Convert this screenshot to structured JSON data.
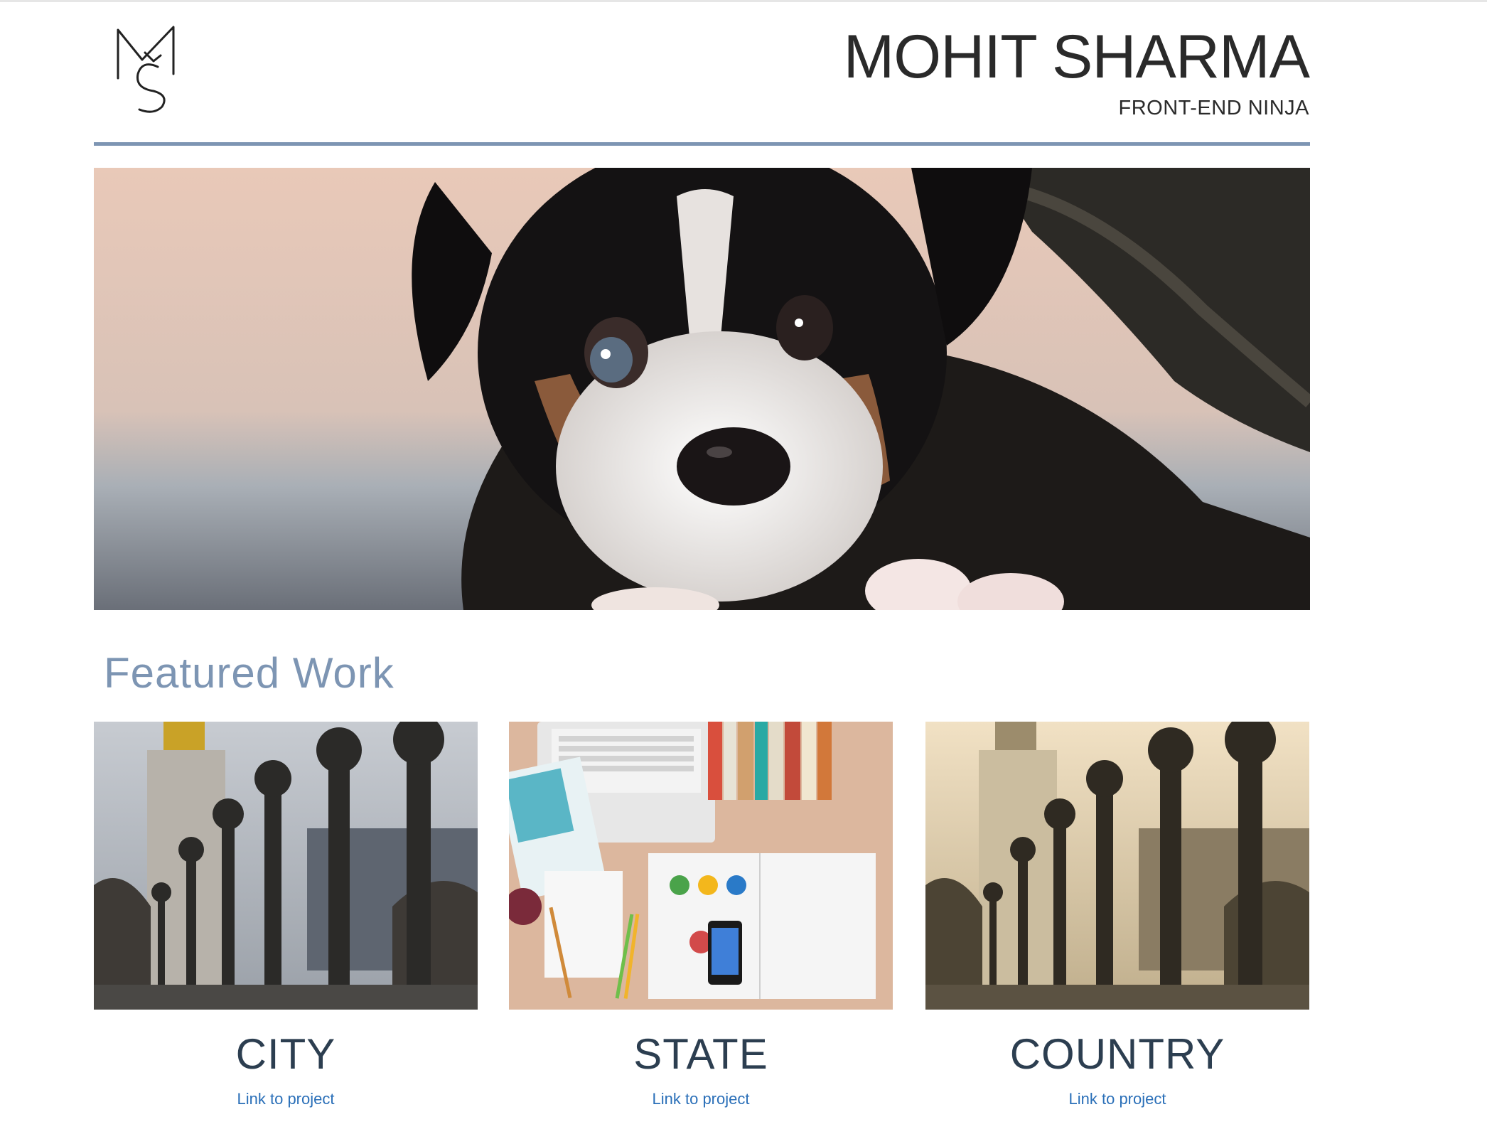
{
  "header": {
    "logo_text": "MS",
    "name": "MOHIT SHARMA",
    "tagline": "FRONT-END NINJA",
    "accent_color": "#7d95b3"
  },
  "hero": {
    "image": "puppy-photo"
  },
  "featured": {
    "title": "Featured Work",
    "cards": [
      {
        "title": "CITY",
        "link": "Link to project",
        "image": "paris-lampposts-photo"
      },
      {
        "title": "STATE",
        "link": "Link to project",
        "image": "desk-flatlay-photo"
      },
      {
        "title": "COUNTRY",
        "link": "Link to project",
        "image": "paris-lampposts-sepia-photo"
      }
    ]
  },
  "colors": {
    "heading": "#2c3e50",
    "link": "#2a6fb8"
  }
}
